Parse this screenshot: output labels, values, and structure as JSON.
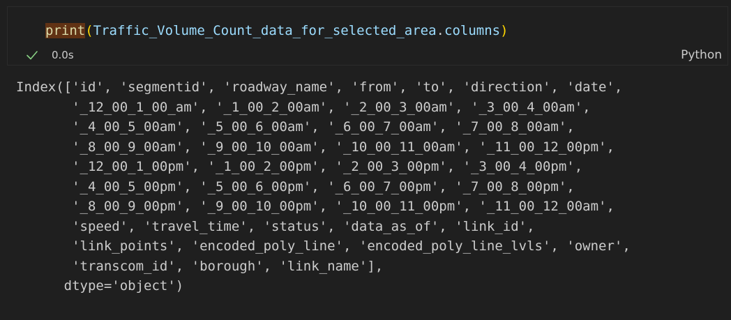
{
  "cell": {
    "code": {
      "function": "print",
      "open_paren": "(",
      "variable": "Traffic_Volume_Count_data_for_selected_area",
      "dot": ".",
      "attribute": "columns",
      "close_paren": ")"
    },
    "status": {
      "icon": "check-icon",
      "duration": "0.0s",
      "language": "Python"
    }
  },
  "output": {
    "lines": [
      "Index(['id', 'segmentid', 'roadway_name', 'from', 'to', 'direction', 'date',",
      "       '_12_00_1_00_am', '_1_00_2_00am', '_2_00_3_00am', '_3_00_4_00am',",
      "       '_4_00_5_00am', '_5_00_6_00am', '_6_00_7_00am', '_7_00_8_00am',",
      "       '_8_00_9_00am', '_9_00_10_00am', '_10_00_11_00am', '_11_00_12_00pm',",
      "       '_12_00_1_00pm', '_1_00_2_00pm', '_2_00_3_00pm', '_3_00_4_00pm',",
      "       '_4_00_5_00pm', '_5_00_6_00pm', '_6_00_7_00pm', '_7_00_8_00pm',",
      "       '_8_00_9_00pm', '_9_00_10_00pm', '_10_00_11_00pm', '_11_00_12_00am',",
      "       'speed', 'travel_time', 'status', 'data_as_of', 'link_id',",
      "       'link_points', 'encoded_poly_line', 'encoded_poly_line_lvls', 'owner',",
      "       'transcom_id', 'borough', 'link_name'],",
      "      dtype='object')"
    ]
  },
  "colors": {
    "background": "#1f1f1f",
    "function": "#dcdcaa",
    "function_highlight": "#613214",
    "paren": "#ffd700",
    "variable": "#9cdcfe",
    "success": "#89d185",
    "text": "#cccccc"
  }
}
